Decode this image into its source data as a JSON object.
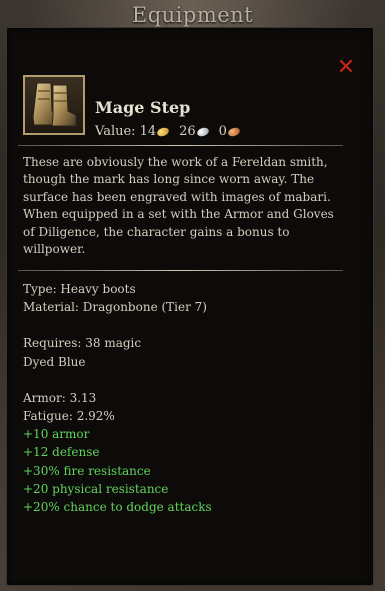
{
  "window": {
    "title": "Equipment"
  },
  "item": {
    "name": "Mage Step",
    "icon": "boots-icon",
    "value_label": "Value:",
    "gold": "14",
    "silver": "26",
    "copper": "0",
    "description": "These are obviously the work of a Fereldan smith, though the mark has long since worn away. The surface has been engraved with images of mabari. When equipped in a set with the Armor and Gloves of Diligence, the character gains a bonus to willpower."
  },
  "properties": {
    "type": "Type: Heavy boots",
    "material": "Material: Dragonbone (Tier 7)",
    "requires": "Requires: 38 magic",
    "dye": "Dyed Blue",
    "armor": "Armor: 3.13",
    "fatigue": "Fatigue: 2.92%"
  },
  "bonuses": [
    "+10 armor",
    "+12 defense",
    "+30% fire resistance",
    "+20 physical resistance",
    "+20% chance to dodge attacks"
  ],
  "colors": {
    "bonus_text": "#63d45c",
    "close_icon": "#c72418",
    "icon_border": "#b49c6f"
  }
}
